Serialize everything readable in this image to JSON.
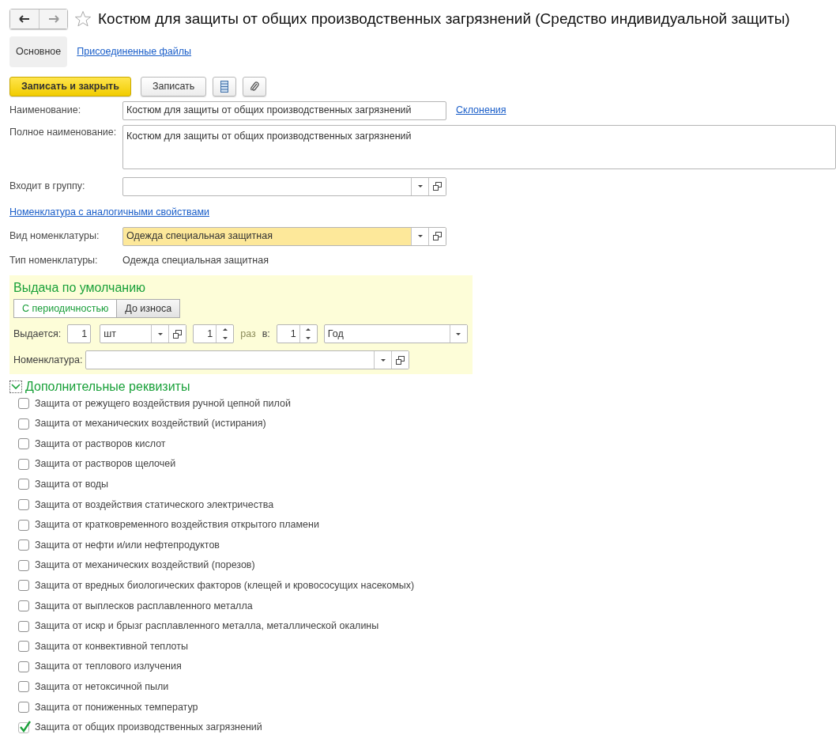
{
  "title": "Костюм для защиты от общих производственных загрязнений (Средство индивидуальной защиты)",
  "favorite": false,
  "tabs": [
    {
      "label": "Основное",
      "selected": true
    },
    {
      "label": "Присоединенные файлы",
      "selected": false
    }
  ],
  "toolbar": {
    "primary": "Записать и закрыть",
    "save": "Записать"
  },
  "name": {
    "label": "Наименование:",
    "value": "Костюм для защиты от общих производственных загрязнений",
    "link": "Склонения"
  },
  "full_name": {
    "label": "Полное наименование:",
    "value": "Костюм для защиты от общих производственных загрязнений"
  },
  "group": {
    "label": "Входит в группу:"
  },
  "similar_link": "Номенклатура с аналогичными свойствами",
  "kind": {
    "label": "Вид номенклатуры:",
    "value": "Одежда специальная защитная",
    "focused": true
  },
  "type": {
    "label": "Тип номенклатуры:",
    "value": "Одежда специальная защитная"
  },
  "issue": {
    "title": "Выдача по умолчанию",
    "modes": [
      {
        "label": "С периодичностью",
        "selected": true
      },
      {
        "label": "До износа",
        "selected": false
      }
    ],
    "issued_label": "Выдается:",
    "quantity": "1",
    "unit": "шт",
    "times": "1",
    "times_label": "раз",
    "per_label": "в:",
    "period_count": "1",
    "period": "Год",
    "nomenclature_label": "Номенклатура:"
  },
  "extra": {
    "title": "Дополнительные реквизиты",
    "expanded": true,
    "items": [
      {
        "label": "Защита от режущего воздействия ручной цепной пилой",
        "checked": false
      },
      {
        "label": "Защита от механических воздействий (истирания)",
        "checked": false
      },
      {
        "label": "Защита от растворов кислот",
        "checked": false
      },
      {
        "label": "Защита от растворов щелочей",
        "checked": false
      },
      {
        "label": "Защита от воды",
        "checked": false
      },
      {
        "label": "Защита от воздействия статического электричества",
        "checked": false
      },
      {
        "label": "Защита от кратковременного воздействия открытого пламени",
        "checked": false
      },
      {
        "label": "Защита от нефти и/или нефтепродуктов",
        "checked": false
      },
      {
        "label": "Защита от механических воздействий (порезов)",
        "checked": false
      },
      {
        "label": "Защита от вредных биологических факторов (клещей и кровососущих насекомых)",
        "checked": false
      },
      {
        "label": "Защита от выплесков расплавленного металла",
        "checked": false
      },
      {
        "label": "Защита от искр и брызг расплавленного металла, металлической окалины",
        "checked": false
      },
      {
        "label": "Защита от конвективной теплоты",
        "checked": false
      },
      {
        "label": "Защита от теплового излучения",
        "checked": false
      },
      {
        "label": "Защита от нетоксичной пыли",
        "checked": false
      },
      {
        "label": "Защита от пониженных температур",
        "checked": false
      },
      {
        "label": "Защита от общих производственных загрязнений",
        "checked": true
      }
    ]
  }
}
